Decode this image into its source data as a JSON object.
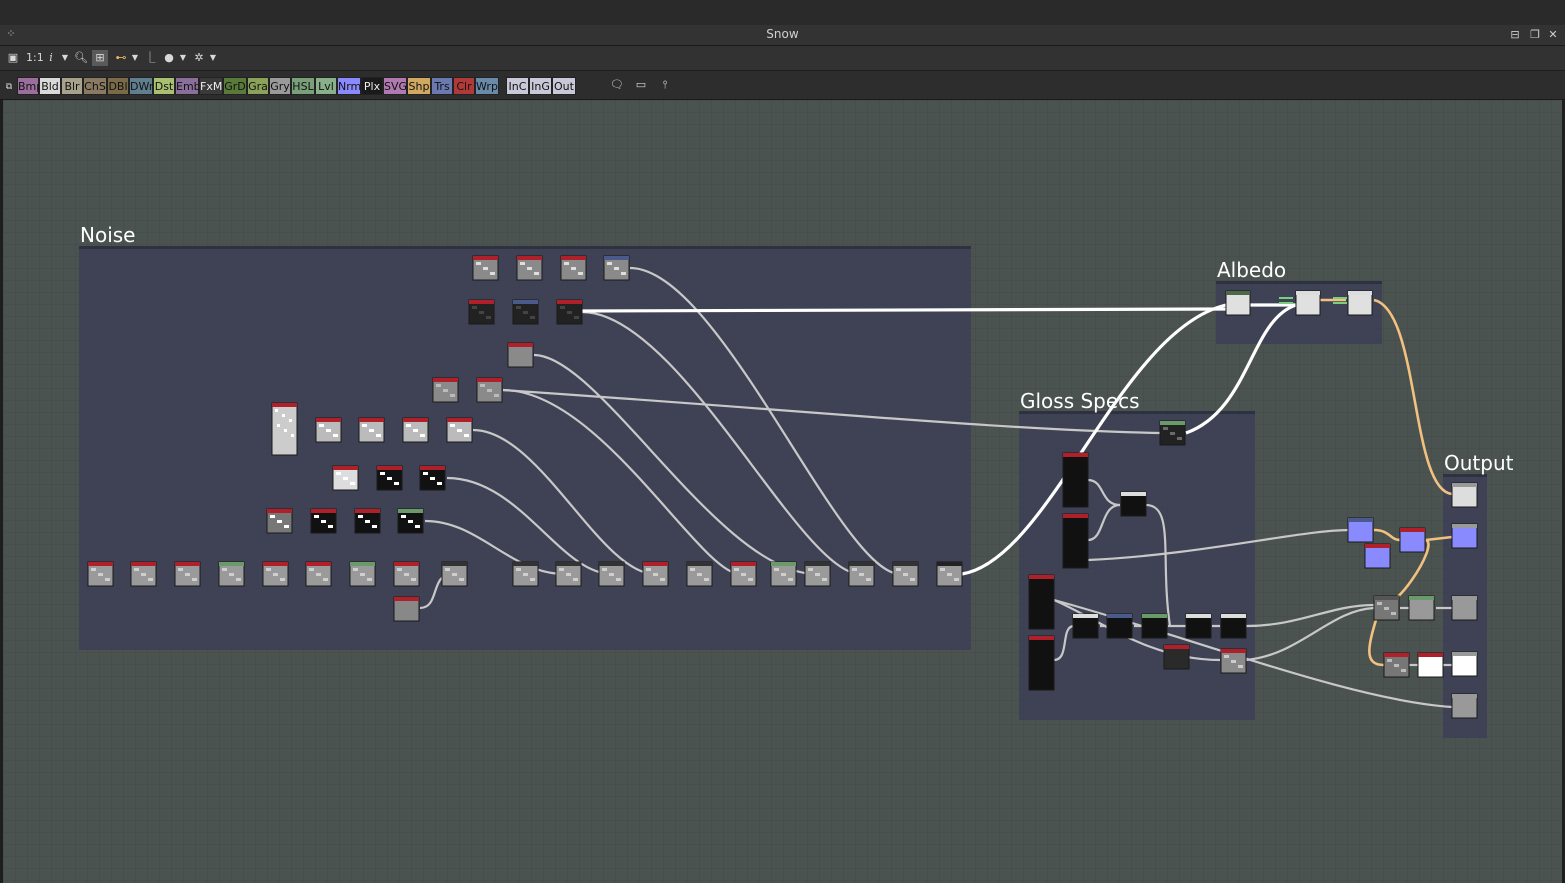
{
  "window": {
    "title": "Snow",
    "buttons": {
      "pin": "⊟",
      "restore": "❐",
      "close": "✕"
    }
  },
  "toolbar": {
    "zoom_label": "1:1",
    "info_label": "i",
    "icons": [
      "fit-icon",
      "zoom-icon",
      "grid-snap-icon",
      "link-style-icon",
      "wire-style-icon",
      "bomb-icon",
      "gear-icon"
    ]
  },
  "node_library": {
    "chips": [
      {
        "label": "Bmp",
        "color": "#9a6f9e"
      },
      {
        "label": "Bld",
        "color": "#d9d9d9"
      },
      {
        "label": "Blr",
        "color": "#a7a28c"
      },
      {
        "label": "ChS",
        "color": "#8a7a62"
      },
      {
        "label": "DBl",
        "color": "#7a6a48"
      },
      {
        "label": "DWr",
        "color": "#5f7f8f"
      },
      {
        "label": "Dst",
        "color": "#a8c070"
      },
      {
        "label": "Emb",
        "color": "#8a6f9a"
      },
      {
        "label": "FxM",
        "color": "#3a3a3a"
      },
      {
        "label": "GrD",
        "color": "#5a7a3a"
      },
      {
        "label": "Gra",
        "color": "#8aa25a"
      },
      {
        "label": "Gry",
        "color": "#9a9a9a"
      },
      {
        "label": "HSL",
        "color": "#7aa07a"
      },
      {
        "label": "Lvl",
        "color": "#8ab08a"
      },
      {
        "label": "Nrm",
        "color": "#8a8aff"
      },
      {
        "label": "Plx",
        "color": "#1a1a1a"
      },
      {
        "label": "SVG",
        "color": "#b07ab0"
      },
      {
        "label": "Shp",
        "color": "#d0a860"
      },
      {
        "label": "Trs",
        "color": "#6a7ab0"
      },
      {
        "label": "Clr",
        "color": "#b03a3a"
      },
      {
        "label": "Wrp",
        "color": "#6a8aaa"
      },
      {
        "label": "InC",
        "color": "#c8c8d8"
      },
      {
        "label": "InG",
        "color": "#c8c8d8"
      },
      {
        "label": "Out",
        "color": "#c8c8d8"
      }
    ],
    "extra_icons": [
      "comment-icon",
      "frame-icon",
      "pin-icon"
    ]
  },
  "frames": {
    "noise": "Noise",
    "albedo": "Albedo",
    "gloss": "Gloss Specs",
    "output": "Output"
  }
}
